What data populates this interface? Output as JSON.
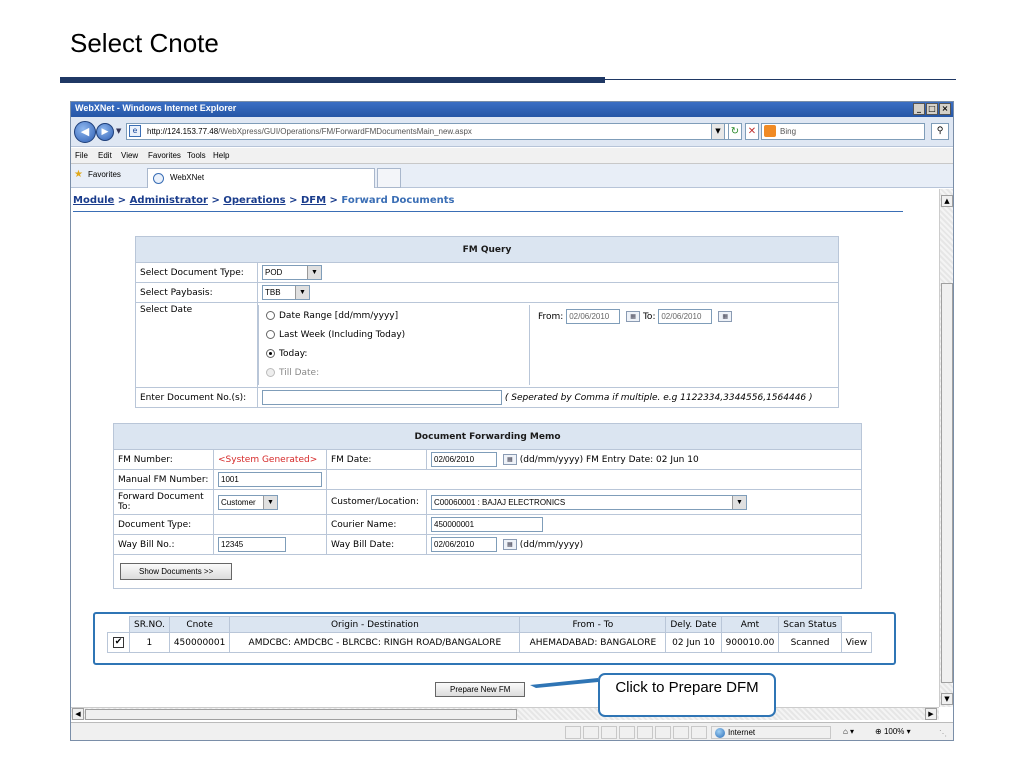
{
  "slide": {
    "title": "Select Cnote"
  },
  "window": {
    "title": "WebXNet - Windows Internet Explorer",
    "controls": [
      "_",
      "□",
      "×"
    ],
    "address_host": "http://124.153.77.48",
    "address_path": "/WebXpress/GUI/Operations/FM/ForwardFMDocumentsMain_new.aspx",
    "search_placeholder": "Bing",
    "menu": [
      "File",
      "Edit",
      "View",
      "Favorites",
      "Tools",
      "Help"
    ],
    "favorites_label": "Favorites",
    "tab_label": "WebXNet",
    "status_zone": "Internet",
    "zoom": "100%"
  },
  "breadcrumb": {
    "module": "Module",
    "sep": ">",
    "admin": "Administrator",
    "ops": "Operations",
    "dfm": "DFM",
    "current": "Forward Documents"
  },
  "fm_query": {
    "header": "FM Query",
    "doc_type_label": "Select Document Type:",
    "doc_type_value": "POD",
    "paybasis_label": "Select Paybasis:",
    "paybasis_value": "TBB",
    "date_label": "Select Date",
    "radio_range": "Date Range [dd/mm/yyyy]",
    "radio_week": "Last Week (Including Today)",
    "radio_today": "Today:",
    "radio_till": "Till Date:",
    "from_label": "From:",
    "from_value": "02/06/2010",
    "to_label": "To:",
    "to_value": "02/06/2010",
    "docno_label": "Enter Document No.(s):",
    "docno_hint": "( Seperated by Comma if multiple. e.g 1122334,3344556,1564446 )"
  },
  "dfm": {
    "header": "Document Forwarding Memo",
    "fm_number_label": "FM Number:",
    "fm_number_value": "<System Generated>",
    "fm_date_label": "FM Date:",
    "fm_date_value": "02/06/2010",
    "date_format": "(dd/mm/yyyy)",
    "fm_entry_label": "FM Entry Date:",
    "fm_entry_value": "02 Jun 10",
    "manual_label": "Manual FM Number:",
    "manual_value": "1001",
    "forward_to_label": "Forward Document To:",
    "forward_to_value": "Customer",
    "customer_label": "Customer/Location:",
    "customer_value": "C00060001 : BAJAJ ELECTRONICS",
    "doc_type_label": "Document Type:",
    "courier_label": "Courier Name:",
    "courier_value": "450000001",
    "waybill_label": "Way Bill No.:",
    "waybill_value": "12345",
    "waybill_date_label": "Way Bill Date:",
    "waybill_date_value": "02/06/2010",
    "show_docs": "Show Documents >>"
  },
  "results": {
    "columns": [
      "SR.NO.",
      "Cnote",
      "Origin - Destination",
      "From - To",
      "Dely. Date",
      "Amt",
      "Scan Status",
      ""
    ],
    "rows": [
      {
        "checked": "✔",
        "sr": "1",
        "cnote": "450000001",
        "origin": "AMDCBC: AMDCBC - BLRCBC: RINGH ROAD/BANGALORE",
        "from_to": "AHEMADABAD: BANGALORE",
        "dely": "02 Jun 10",
        "amt": "900010.00",
        "status": "Scanned",
        "action": "View"
      }
    ]
  },
  "prepare_button": "Prepare New FM",
  "callout": "Click to Prepare DFM",
  "colors": {
    "accent": "#2f75b5",
    "header_bg": "#dbe5f1",
    "link": "#1a3c8c",
    "system_text": "#d62a2a"
  }
}
